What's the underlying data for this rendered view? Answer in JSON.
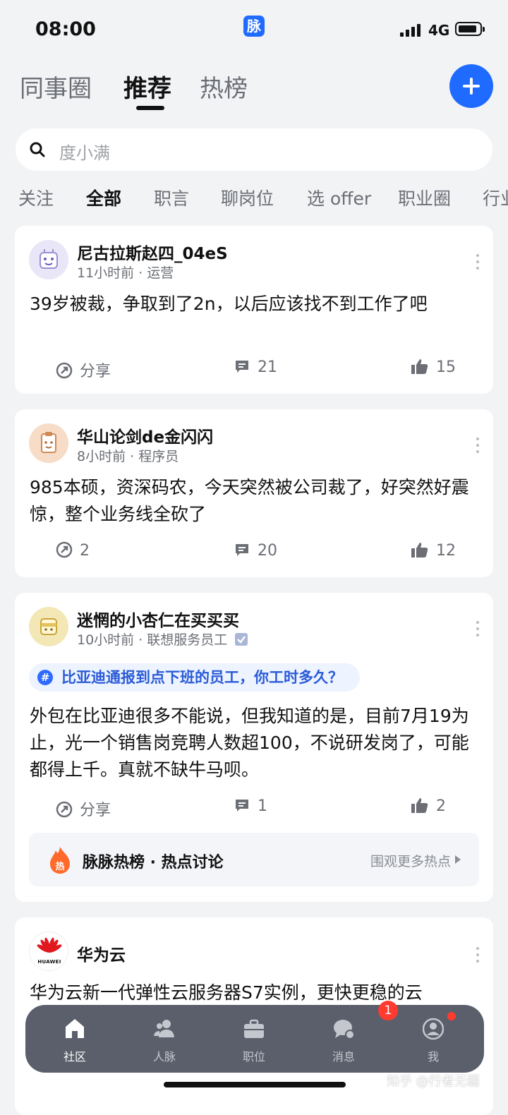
{
  "status_bar": {
    "time": "08:00",
    "app_badge": "脉",
    "network": "4G"
  },
  "top_tabs": [
    {
      "label": "同事圈"
    },
    {
      "label": "推荐",
      "active": true
    },
    {
      "label": "热榜"
    }
  ],
  "search": {
    "placeholder": "度小满"
  },
  "categories": [
    "关注",
    "全部",
    "职言",
    "聊岗位",
    "选 offer",
    "职业圈",
    "行业"
  ],
  "active_category": "全部",
  "posts": [
    {
      "author": "尼古拉斯赵四_04eS",
      "meta": "11小时前 · 运营",
      "content": "39岁被裁，争取到了2n，以后应该找不到工作了吧",
      "share": "分享",
      "comments": "21",
      "likes": "15"
    },
    {
      "author": "华山论剑de金闪闪",
      "meta": "8小时前 · 程序员",
      "content": "985本硕，资深码农，今天突然被公司裁了，好突然好震惊，整个业务线全砍了",
      "share": "2",
      "comments": "20",
      "likes": "12"
    },
    {
      "author": "迷惘的小杏仁在买买买",
      "meta": "10小时前 · 联想服务员工",
      "topic": "比亚迪通报到点下班的员工，你工时多久？",
      "content": "外包在比亚迪很多不能说，但我知道的是，目前7月19为止，光一个销售岗竞聘人数超100，不说研发岗了，可能都得上千。真就不缺牛马呗。",
      "share": "分享",
      "comments": "1",
      "likes": "2",
      "hot_banner": {
        "label": "脉脉热榜 · 热点讨论",
        "more": "围观更多热点",
        "flame_char": "热"
      }
    },
    {
      "author": "华为云",
      "logo_text": "HUAWEI",
      "content": "华为云新一代弹性云服务器S7实例，更快更稳的云"
    }
  ],
  "bottom_nav": [
    {
      "label": "社区",
      "icon": "home-icon",
      "active": true
    },
    {
      "label": "人脉",
      "icon": "contacts-icon"
    },
    {
      "label": "职位",
      "icon": "briefcase-icon"
    },
    {
      "label": "消息",
      "icon": "message-icon",
      "badge": "1"
    },
    {
      "label": "我",
      "icon": "profile-icon",
      "dot": true
    }
  ],
  "watermark": "知乎 @行者无疆",
  "colors": {
    "accent": "#1f6bff",
    "background": "#f2f3f5",
    "nav_bg": "#5b5f6b",
    "badge": "#ff3b30"
  }
}
